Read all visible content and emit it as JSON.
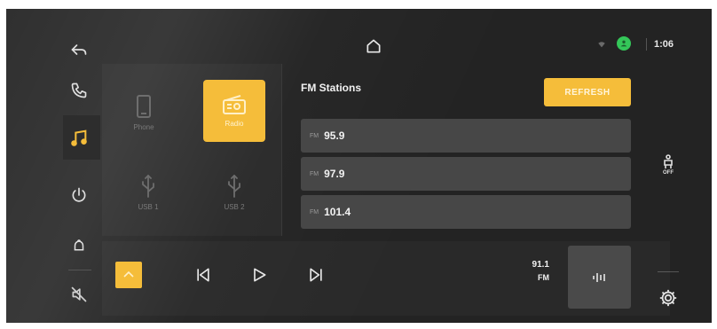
{
  "header": {
    "time": "1:06",
    "home_icon": "home-icon",
    "wifi_icon": "wifi-icon",
    "status_icon": "profile-status-icon",
    "status_color": "#34c759"
  },
  "left_rail": {
    "items": [
      {
        "name": "back",
        "icon": "back-arrow-icon"
      },
      {
        "name": "phone",
        "icon": "phone-icon"
      },
      {
        "name": "music",
        "icon": "music-note-icon",
        "active": true
      },
      {
        "name": "power",
        "icon": "power-icon"
      },
      {
        "name": "notifications",
        "icon": "bell-icon"
      },
      {
        "name": "mute",
        "icon": "volume-mute-icon"
      }
    ]
  },
  "sources": {
    "items": [
      {
        "label": "Phone",
        "icon": "phone-device-icon"
      },
      {
        "label": "Radio",
        "icon": "radio-icon",
        "active": true
      },
      {
        "label": "USB 1",
        "icon": "usb-icon"
      },
      {
        "label": "USB 2",
        "icon": "usb-icon"
      }
    ]
  },
  "stations": {
    "title": "FM Stations",
    "refresh_label": "REFRESH",
    "list": [
      {
        "band": "FM",
        "freq": "95.9"
      },
      {
        "band": "FM",
        "freq": "97.9"
      },
      {
        "band": "FM",
        "freq": "101.4"
      }
    ]
  },
  "right_rail": {
    "seat_label": "OFF",
    "seat_icon": "seat-heater-icon",
    "settings_icon": "gear-icon"
  },
  "player": {
    "now_freq": "91.1",
    "now_band": "FM",
    "prev_icon": "skip-previous-icon",
    "play_icon": "play-icon",
    "next_icon": "skip-next-icon",
    "eq_icon": "audio-wave-icon",
    "accent": "#f5bd3a"
  }
}
